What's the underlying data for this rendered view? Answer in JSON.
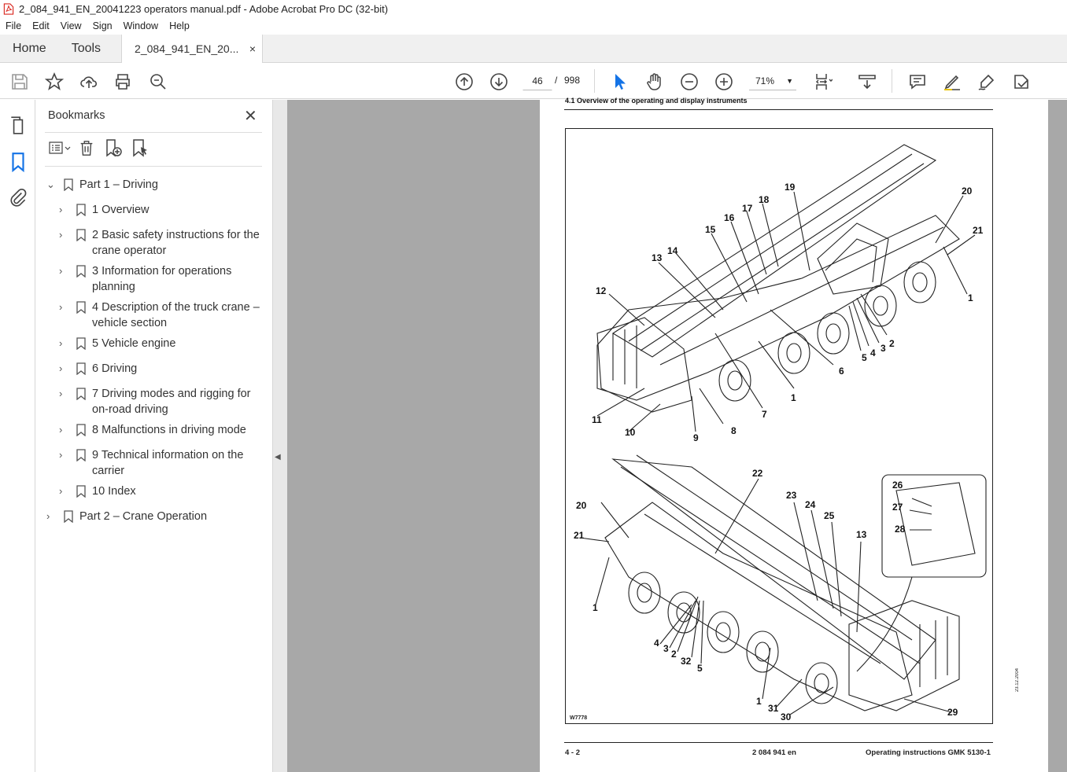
{
  "window": {
    "title": "2_084_941_EN_20041223 operators manual.pdf - Adobe Acrobat Pro DC (32-bit)"
  },
  "menu": [
    "File",
    "Edit",
    "View",
    "Sign",
    "Window",
    "Help"
  ],
  "tabs": {
    "home": "Home",
    "tools": "Tools",
    "document": "2_084_941_EN_20...",
    "close": "×"
  },
  "toolbar": {
    "page_current": "46",
    "page_sep": "/",
    "page_total": "998",
    "zoom": "71%"
  },
  "bookmarks": {
    "title": "Bookmarks",
    "close": "✕",
    "items": [
      {
        "label": "Part 1 – Driving",
        "chevron": "⌄"
      },
      {
        "label": "1 Overview",
        "chevron": "›"
      },
      {
        "label": "2 Basic safety instructions for the crane operator",
        "chevron": "›"
      },
      {
        "label": "3 Information for operations planning",
        "chevron": "›"
      },
      {
        "label": "4 Description of the truck crane – vehicle section",
        "chevron": "›"
      },
      {
        "label": "5 Vehicle engine",
        "chevron": "›"
      },
      {
        "label": "6 Driving",
        "chevron": "›"
      },
      {
        "label": "7 Driving modes and rigging for on-road driving",
        "chevron": "›"
      },
      {
        "label": "8 Malfunctions in driving mode",
        "chevron": "›"
      },
      {
        "label": "9 Technical information on the carrier",
        "chevron": "›"
      },
      {
        "label": "10 Index",
        "chevron": "›"
      },
      {
        "label": "Part 2 – Crane Operation",
        "chevron": "›"
      }
    ]
  },
  "page": {
    "header": "4.1 Overview of the operating and display instruments",
    "figure_code": "W7778",
    "side_date": "23.12.2004",
    "footer_left": "4 - 2",
    "footer_center": "2 084 941 en",
    "footer_right": "Operating instructions GMK 5130-1",
    "callouts": [
      "19",
      "20",
      "18",
      "17",
      "21",
      "16",
      "15",
      "14",
      "13",
      "1",
      "12",
      "2",
      "3",
      "4",
      "5",
      "6",
      "1",
      "7",
      "11",
      "8",
      "10",
      "9",
      "22",
      "26",
      "23",
      "24",
      "27",
      "20",
      "25",
      "28",
      "13",
      "21",
      "1",
      "4",
      "3",
      "2",
      "32",
      "5",
      "1",
      "31",
      "30",
      "29"
    ]
  },
  "colors": {
    "doc_bg": "#a8a8a8",
    "accent_blue": "#1473e6",
    "pdf_red": "#d9241c"
  }
}
